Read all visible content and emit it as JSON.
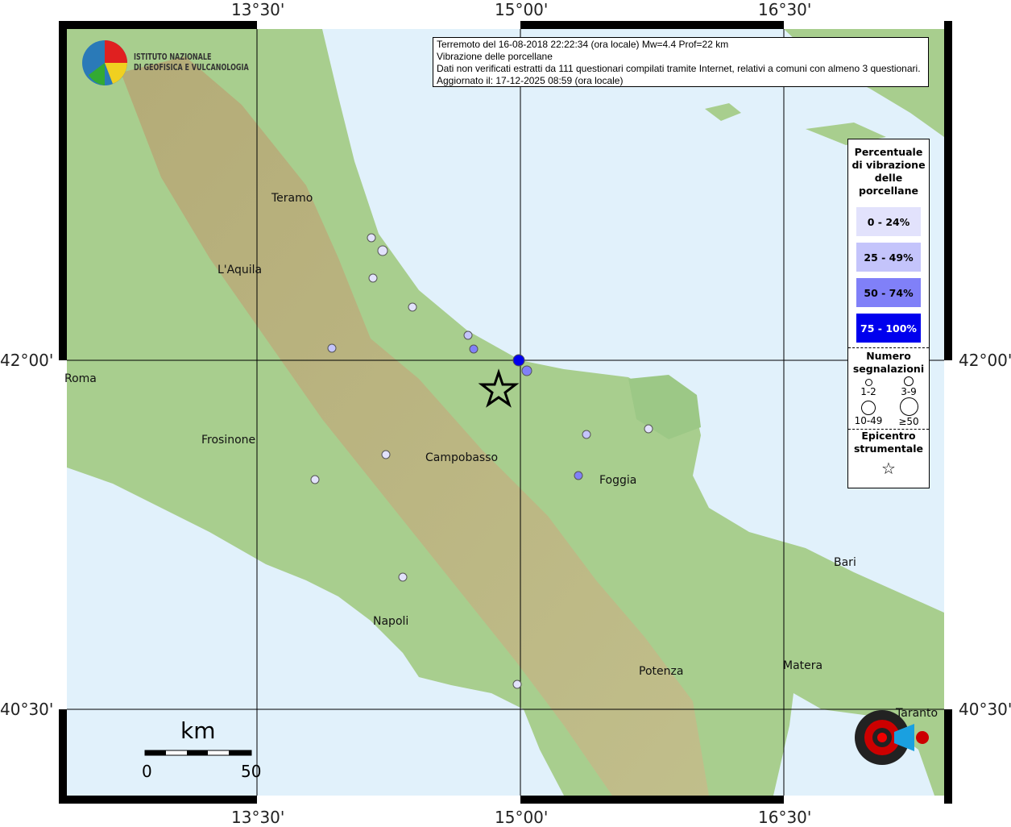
{
  "header": {
    "line1": "Terremoto del 16-08-2018 22:22:34 (ora locale) Mw=4.4 Prof=22 km",
    "line2": "Vibrazione delle porcellane",
    "line3": "Dati non verificati estratti da 111 questionari compilati tramite Internet, relativi a comuni con almeno 3 questionari.",
    "line4": "Aggiornato il: 17-12-2025 08:59 (ora locale)"
  },
  "logo": {
    "line1": "ISTITUTO NAZIONALE",
    "line2": "DI GEOFISICA E VULCANOLOGIA"
  },
  "hst_logo": "www.haisentitoilterremoto.it",
  "axes": {
    "lon": [
      "13°30'",
      "15°00'",
      "16°30'"
    ],
    "lat": [
      "42°00'",
      "40°30'"
    ]
  },
  "cities": [
    "Teramo",
    "L'Aquila",
    "Roma",
    "Frosinone",
    "Campobasso",
    "Foggia",
    "Napoli",
    "Potenza",
    "Bari",
    "Matera",
    "Taranto"
  ],
  "legend": {
    "title": "Percentuale di vibrazione delle porcellane",
    "classes": [
      {
        "label": "0 - 24%",
        "color": "#e2e2fc"
      },
      {
        "label": "25 - 49%",
        "color": "#c4c4fb"
      },
      {
        "label": "50 - 74%",
        "color": "#8080f8"
      },
      {
        "label": "75 - 100%",
        "color": "#0000ee"
      }
    ],
    "count_title": "Numero segnalazioni",
    "sizes": [
      "1-2",
      "3-9",
      "10-49",
      "≥50"
    ],
    "epicenter_title": "Epicentro strumentale"
  },
  "scale": {
    "unit": "km",
    "min": "0",
    "max": "50"
  },
  "colors": {
    "sea": "#e1f1fb",
    "land": "#a9cf90",
    "frame": "#000000"
  }
}
